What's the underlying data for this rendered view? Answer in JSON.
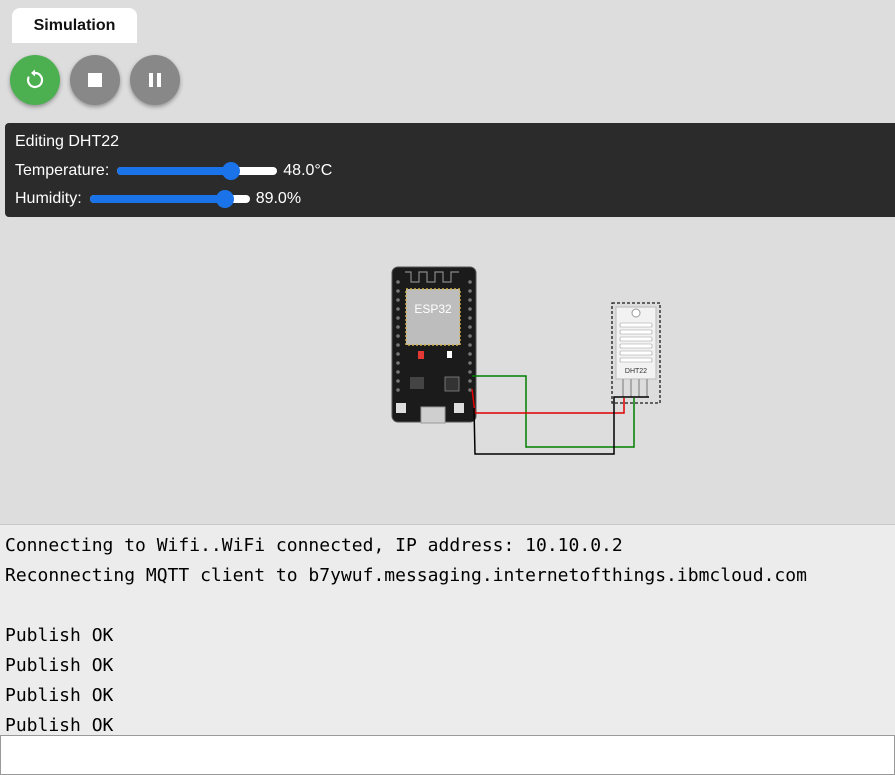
{
  "tab": {
    "label": "Simulation"
  },
  "controls": {
    "restart_color": "#4caf50",
    "stop_color": "#888888",
    "pause_color": "#888888",
    "restart_icon": "restart-icon",
    "stop_icon": "stop-icon",
    "pause_icon": "pause-icon"
  },
  "editor": {
    "title": "Editing DHT22",
    "temperature": {
      "label": "Temperature:",
      "value": "48.0°C",
      "fraction": 0.71
    },
    "humidity": {
      "label": "Humidity:",
      "value": "89.0%",
      "fraction": 0.845
    }
  },
  "diagram": {
    "board_label": "ESP32",
    "sensor_label": "DHT22",
    "wire_colors": [
      "#008000",
      "#e00000",
      "#000000"
    ]
  },
  "console": {
    "lines": [
      "Connecting to Wifi..WiFi connected, IP address: 10.10.0.2",
      "Reconnecting MQTT client to b7ywuf.messaging.internetofthings.ibmcloud.com",
      "",
      "Publish OK",
      "Publish OK",
      "Publish OK",
      "Publish OK"
    ]
  },
  "input": {
    "value": ""
  }
}
